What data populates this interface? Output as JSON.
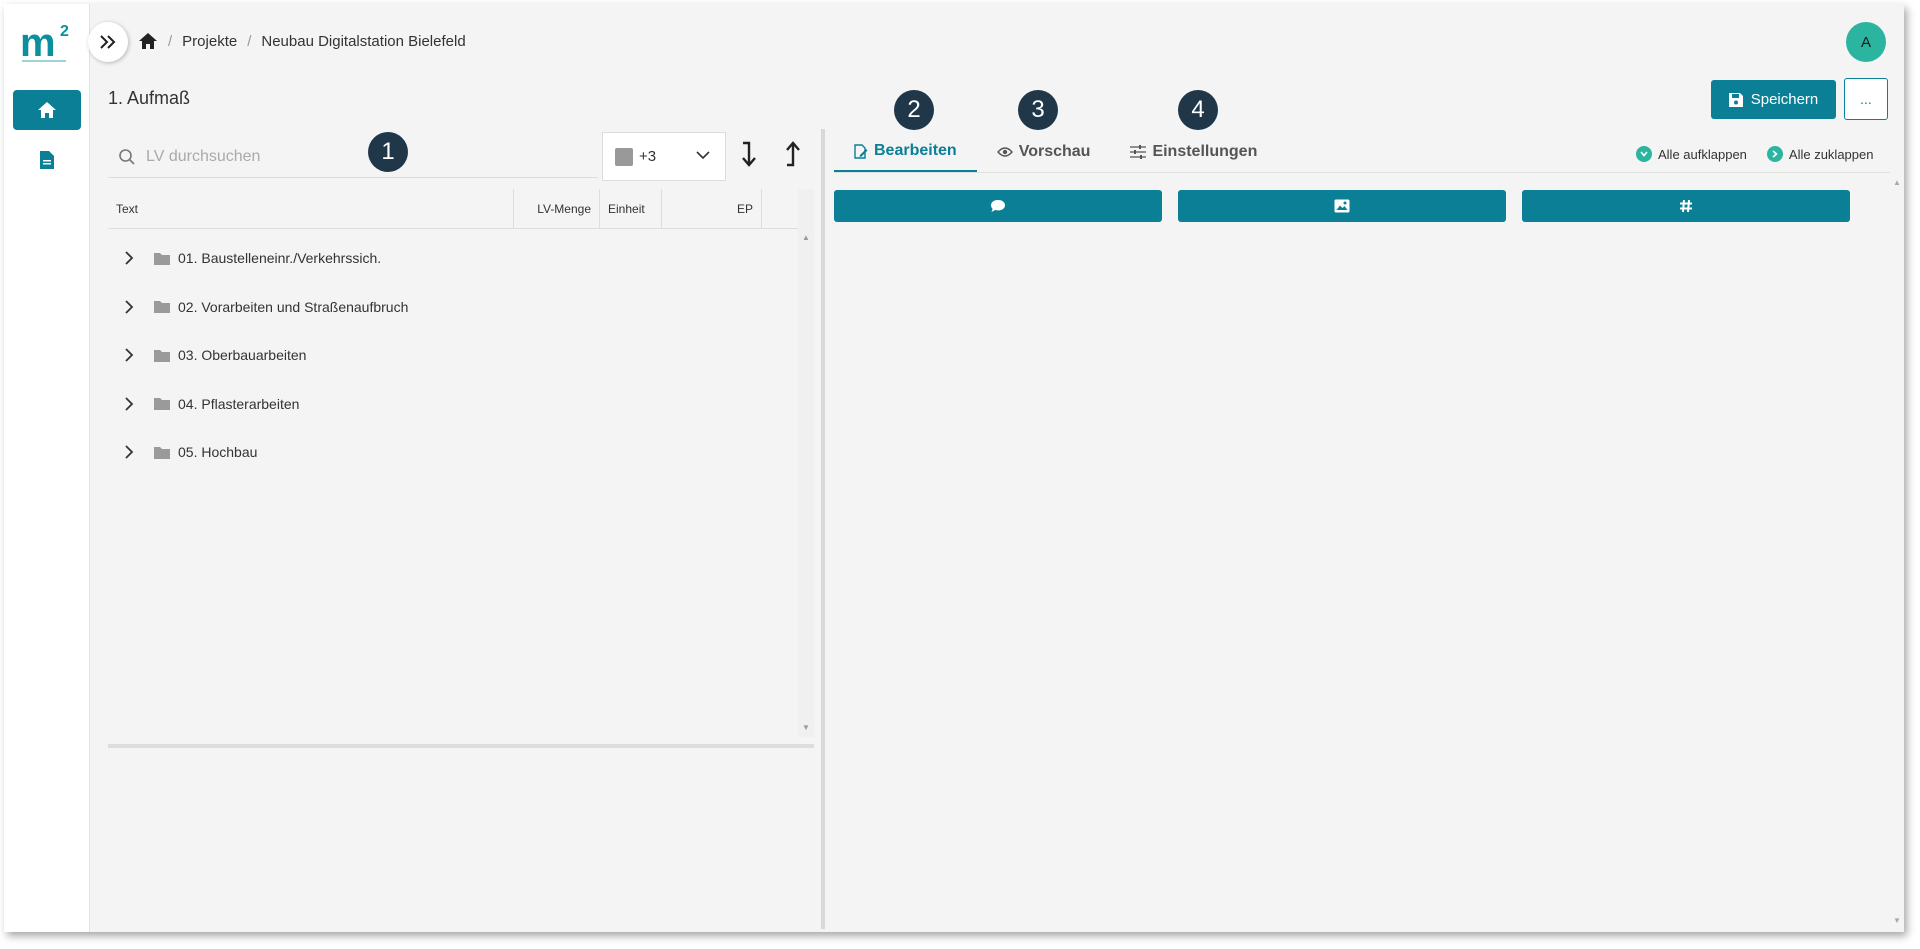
{
  "breadcrumb": {
    "items": [
      "Projekte",
      "Neubau Digitalstation Bielefeld"
    ]
  },
  "user": {
    "avatar_initial": "A"
  },
  "page": {
    "title": "1. Aufmaß"
  },
  "toolbar": {
    "save_label": "Speichern",
    "more_label": "..."
  },
  "search": {
    "placeholder": "LV durchsuchen"
  },
  "filter": {
    "label": "+3"
  },
  "table": {
    "columns": [
      "Text",
      "LV-Menge",
      "Einheit",
      "EP"
    ],
    "rows": [
      "01. Baustelleneinr./Verkehrssich.",
      "02. Vorarbeiten und Straßenaufbruch",
      "03. Oberbauarbeiten",
      "04. Pflasterarbeiten",
      "05. Hochbau"
    ]
  },
  "tabs": [
    "Bearbeiten",
    "Vorschau",
    "Einstellungen"
  ],
  "links": {
    "expand_all": "Alle aufklappen",
    "collapse_all": "Alle zuklappen"
  },
  "badges": [
    "1",
    "2",
    "3",
    "4"
  ],
  "colors": {
    "accent": "#0b7f96",
    "badge": "#203649",
    "avatar": "#2bb5a0"
  }
}
